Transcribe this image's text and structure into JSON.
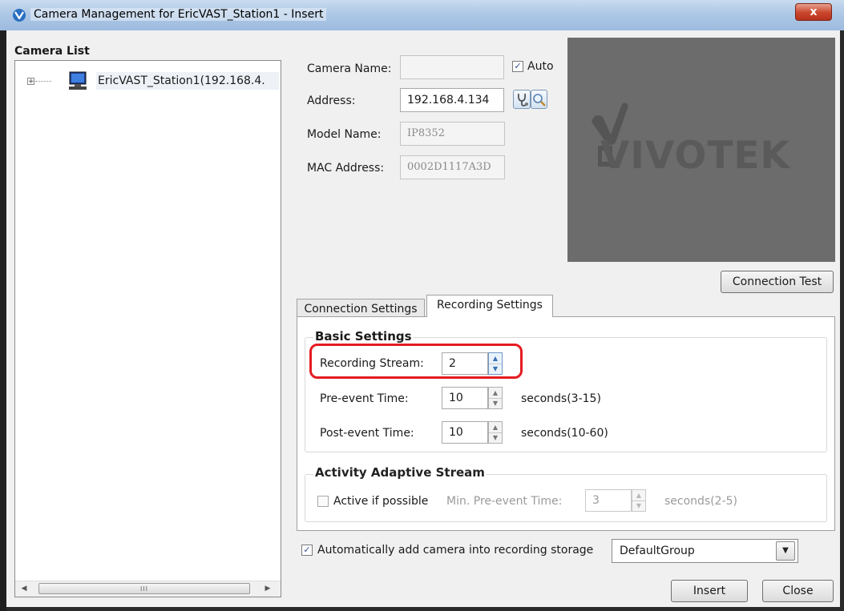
{
  "window": {
    "title": "Camera Management for EricVAST_Station1 - Insert",
    "close_glyph": "x"
  },
  "camera_list": {
    "title": "Camera List",
    "items": [
      {
        "label": "EricVAST_Station1(192.168.4.",
        "expand_glyph": "+",
        "icon": "computer-icon"
      }
    ],
    "scroll_thumb_glyph": "III",
    "scroll_left_glyph": "◀",
    "scroll_right_glyph": "▶"
  },
  "camera": {
    "name_label": "Camera Name:",
    "name_value": "",
    "auto_label": "Auto",
    "auto_checked": true,
    "address_label": "Address:",
    "address_value": "192.168.4.134",
    "model_label": "Model Name:",
    "model_value": "IP8352",
    "mac_label": "MAC Address:",
    "mac_value": "0002D1117A3D"
  },
  "preview": {
    "logo_text": "VIVOTEK"
  },
  "buttons": {
    "connection_test": "Connection Test",
    "insert": "Insert",
    "close": "Close"
  },
  "tabs": [
    {
      "label": "Connection Settings",
      "active": false
    },
    {
      "label": "Recording Settings",
      "active": true
    }
  ],
  "basic_settings": {
    "title": "Basic Settings",
    "recording_stream_label": "Recording Stream:",
    "recording_stream_value": "2",
    "pre_event_label": "Pre-event Time:",
    "pre_event_value": "10",
    "pre_event_unit": "seconds(3-15)",
    "post_event_label": "Post-event Time:",
    "post_event_value": "10",
    "post_event_unit": "seconds(10-60)"
  },
  "activity_adaptive": {
    "title": "Activity Adaptive Stream",
    "active_label": "Active if possible",
    "active_checked": false,
    "min_pre_event_label": "Min. Pre-event Time:",
    "min_pre_event_value": "3",
    "min_pre_event_unit": "seconds(2-5)"
  },
  "footer": {
    "auto_add_label": "Automatically add camera into recording storage",
    "auto_add_checked": true,
    "group_value": "DefaultGroup"
  },
  "glyphs": {
    "check": "✓",
    "spin_up": "▲",
    "spin_down": "▼",
    "dropdown": "▼"
  },
  "colors": {
    "highlight": "#e51b23",
    "titlebar": "#aec8e6",
    "preview_bg": "#6c6c6c"
  }
}
